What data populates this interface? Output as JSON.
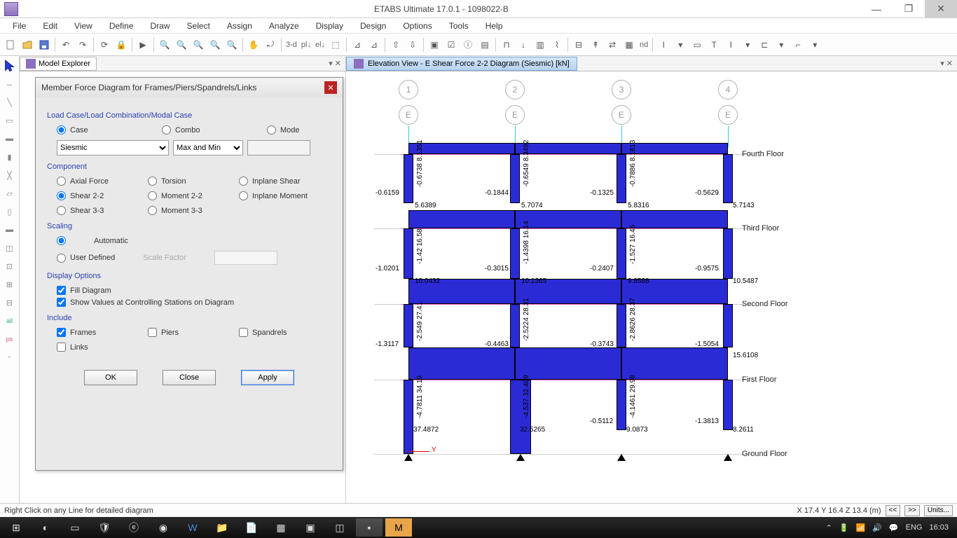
{
  "window": {
    "title": "ETABS Ultimate 17.0.1 - 1098022-B"
  },
  "menu": [
    "File",
    "Edit",
    "View",
    "Define",
    "Draw",
    "Select",
    "Assign",
    "Analyze",
    "Display",
    "Design",
    "Options",
    "Tools",
    "Help"
  ],
  "toolbar_text": {
    "three_d": "3-d",
    "nd": "nd"
  },
  "left_tab": {
    "label": "Model Explorer"
  },
  "view_tab": {
    "label": "Elevation View - E   Shear Force 2-2 Diagram   (Siesmic)  [kN]"
  },
  "dialog": {
    "title": "Member Force Diagram for Frames/Piers/Spandrels/Links",
    "section_loadcase": "Load Case/Load Combination/Modal Case",
    "radio_case": "Case",
    "radio_combo": "Combo",
    "radio_mode": "Mode",
    "case_value": "Siesmic",
    "minmax_value": "Max and Min",
    "section_component": "Component",
    "comp_axial": "Axial Force",
    "comp_torsion": "Torsion",
    "comp_inshear": "Inplane Shear",
    "comp_shear22": "Shear 2-2",
    "comp_moment22": "Moment 2-2",
    "comp_inmoment": "Inplane Moment",
    "comp_shear33": "Shear 3-3",
    "comp_moment33": "Moment 3-3",
    "section_scaling": "Scaling",
    "scale_auto": "Automatic",
    "scale_user": "User Defined",
    "scale_factor_label": "Scale Factor",
    "section_display": "Display Options",
    "disp_fill": "Fill Diagram",
    "disp_values": "Show Values at Controlling Stations on Diagram",
    "section_include": "Include",
    "inc_frames": "Frames",
    "inc_piers": "Piers",
    "inc_spandrels": "Spandrels",
    "inc_links": "Links",
    "btn_ok": "OK",
    "btn_close": "Close",
    "btn_apply": "Apply"
  },
  "grids": {
    "g1": "1",
    "g2": "2",
    "g3": "3",
    "g4": "4",
    "ge": "E"
  },
  "floors": {
    "fourth": "Fourth Floor",
    "third": "Third Floor",
    "second": "Second Floor",
    "first": "First Floor",
    "ground": "Ground Floor"
  },
  "beam_values": {
    "r4": {
      "c1l": "-0.6159",
      "c1r": "-0.1844",
      "c2l": "",
      "c2r": "-0.1325",
      "c3l": "",
      "c3r": "-0.5629"
    },
    "r3v": {
      "c1a": "5.6389",
      "c1b": "5.7074",
      "c2a": "",
      "c2b": "5.8316",
      "c3a": "",
      "c3b": "5.7143"
    },
    "r3": {
      "c1l": "-1.0201",
      "c1r": "-0.3015",
      "c2l": "",
      "c2r": "-0.2407",
      "c3l": "",
      "c3r": "-0.9575"
    },
    "r2v": {
      "c1a": "10.0432",
      "c1b": "10.1365",
      "c2a": "",
      "c2b": "9.9588",
      "c3a": "",
      "c3b": "10.5487"
    },
    "r2": {
      "c1l": "-1.3117",
      "c1r": "-0.4463",
      "c2l": "",
      "c2r": "-0.3743",
      "c3l": "",
      "c3r": "-1.5054"
    },
    "r1v": {
      "c1a": "",
      "c1b": "",
      "c2a": "",
      "c2b": "",
      "c3a": "",
      "c3b": "15.6108"
    },
    "rg": {
      "c1": "37.4872",
      "c2": "32.5265",
      "c3l": "-0.5112",
      "c3": "9.0873",
      "c4l": "-1.3813",
      "c4": "8.2611"
    }
  },
  "col_values": {
    "f4": {
      "c1": "-0.6738  8.1351",
      "c2": "-0.6549  8.3492",
      "c3": "-0.7886  8.1813"
    },
    "f3": {
      "c1": "-1.42   16.58",
      "c2": "-1.4398  16.14",
      "c3": "-1.527   16.45"
    },
    "f2": {
      "c1": "-2.549  27.41",
      "c2": "-2.5224  28.31",
      "c3": "-2.8626  28.37"
    },
    "f1": {
      "c1": "-4.7811  34.19",
      "c2": "-4.537   32.409",
      "c3": "-4.1461  29.98"
    }
  },
  "axis": {
    "y": "Y"
  },
  "status": {
    "hint": "Right Click on any Line for detailed diagram",
    "coords": "X 17.4  Y 16.4  Z 13.4 (m)",
    "prev": "<<",
    "next": ">>",
    "units": "Units..."
  },
  "tray": {
    "lang": "ENG",
    "time": "16:03"
  }
}
